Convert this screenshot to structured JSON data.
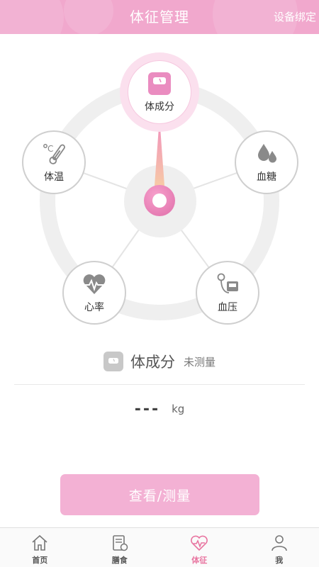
{
  "header": {
    "title": "体征管理",
    "bind_label": "设备绑定"
  },
  "wheel": {
    "items": [
      {
        "key": "body",
        "label": "体成分",
        "icon": "scale-icon",
        "active": true
      },
      {
        "key": "temperature",
        "label": "体温",
        "icon": "thermometer-icon",
        "active": false
      },
      {
        "key": "glucose",
        "label": "血糖",
        "icon": "blood-drops-icon",
        "active": false
      },
      {
        "key": "heart",
        "label": "心率",
        "icon": "heart-rate-icon",
        "active": false
      },
      {
        "key": "pressure",
        "label": "血压",
        "icon": "blood-pressure-icon",
        "active": false
      }
    ]
  },
  "measurement": {
    "name": "体成分",
    "status": "未测量",
    "value": "---",
    "unit": "kg"
  },
  "actions": {
    "main_label": "查看/测量"
  },
  "nav": {
    "items": [
      {
        "label": "首页",
        "icon": "home-icon",
        "active": false
      },
      {
        "label": "膳食",
        "icon": "diet-icon",
        "active": false
      },
      {
        "label": "体征",
        "icon": "heart-pulse-icon",
        "active": true
      },
      {
        "label": "我",
        "icon": "user-icon",
        "active": false
      }
    ]
  },
  "colors": {
    "brand": "#f1a8cd",
    "button": "#f3b1d4",
    "active_nav": "#e8739f",
    "ring": "#efefef"
  }
}
